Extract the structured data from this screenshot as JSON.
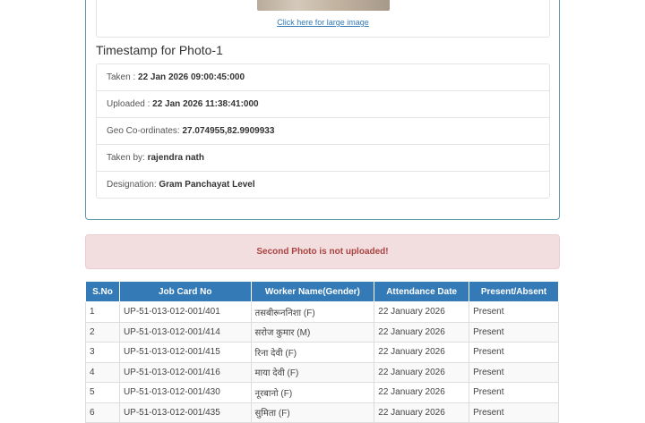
{
  "photo1": {
    "large_link": "Click here for large image",
    "timestamp_title": "Timestamp for Photo-1",
    "details": [
      {
        "label": "Taken : ",
        "value": "22 Jan 2026 09:00:45:000"
      },
      {
        "label": "Uploaded : ",
        "value": "22 Jan 2026 11:38:41:000"
      },
      {
        "label": "Geo Co-ordinates: ",
        "value": "27.074955,82.9909933"
      },
      {
        "label": "Taken by: ",
        "value": "rajendra nath"
      },
      {
        "label": "Designation: ",
        "value": "Gram Panchayat Level"
      }
    ]
  },
  "alert": {
    "message": "Second Photo is not uploaded!"
  },
  "table": {
    "headers": [
      "S.No",
      "Job Card No",
      "Worker Name(Gender)",
      "Attendance Date",
      "Present/Absent"
    ],
    "rows": [
      [
        "1",
        "UP-51-013-012-001/401",
        "तसबीरूननिशा (F)",
        "22 January 2026",
        "Present"
      ],
      [
        "2",
        "UP-51-013-012-001/414",
        "सरोज कुमार (M)",
        "22 January 2026",
        "Present"
      ],
      [
        "3",
        "UP-51-013-012-001/415",
        "रिना देवी (F)",
        "22 January 2026",
        "Present"
      ],
      [
        "4",
        "UP-51-013-012-001/416",
        "माया देवी (F)",
        "22 January 2026",
        "Present"
      ],
      [
        "5",
        "UP-51-013-012-001/430",
        "नूरबानो (F)",
        "22 January 2026",
        "Present"
      ],
      [
        "6",
        "UP-51-013-012-001/435",
        "सुमिता (F)",
        "22 January 2026",
        "Present"
      ]
    ]
  },
  "colors": {
    "accent": "#337ab7",
    "alert_bg": "#f2dede",
    "alert_text": "#a94442",
    "panel_border": "#5b9aa8"
  }
}
